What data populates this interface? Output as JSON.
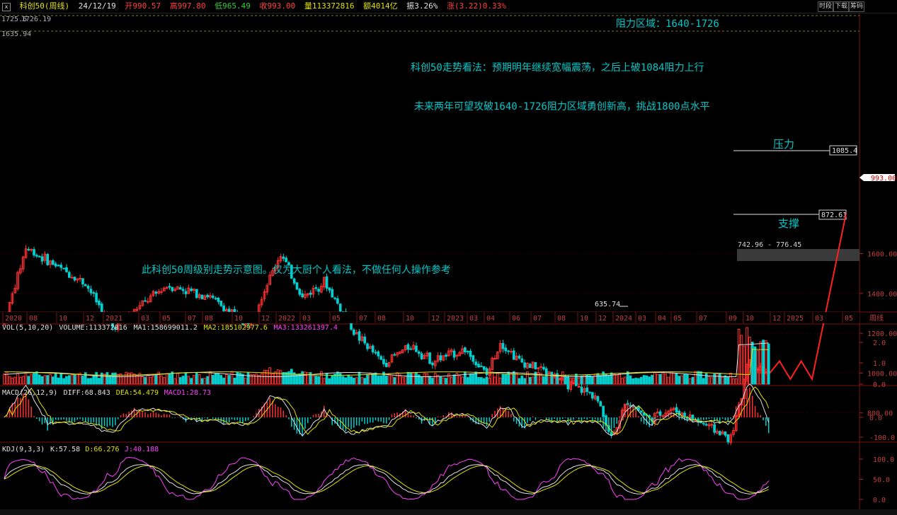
{
  "header": {
    "title": "科创50(周线)",
    "date": "24/12/19",
    "open": "开990.57",
    "high": "高997.80",
    "low": "低965.49",
    "close": "收993.00",
    "volume": "量113372816",
    "amount": "额4014亿",
    "amplitude": "振3.26%",
    "change": "涨(3.22)0.33%",
    "buttons": [
      "时段",
      "下载",
      "筹码"
    ]
  },
  "indicators": {
    "vol": [
      "VOL(5,10,20)",
      "VOLUME:113372816",
      "MA1:158699011.2",
      "MA2:185102977.6",
      "MA3:133261397.4"
    ],
    "macd": [
      "MACD(26,12,9)",
      "DIFF:68.843",
      "DEA:54.479",
      "MACD1:28.73"
    ],
    "kdj": [
      "KDJ(9,3,3)",
      "K:57.58",
      "D:66.276",
      "J:40.188"
    ]
  },
  "annotations": {
    "resistance_zone": "阻力区域：1640-1726",
    "forecast_1": "科创50走势看法：预期明年继续宽幅震荡，之后上破1084阻力上行",
    "forecast_2": "未来两年可望攻破1640-1726阻力区域勇创新高，挑战1800点水平",
    "disclaimer": "此科创50周级别走势示意图。仅为大厨个人看法，不做任何人操作参考",
    "pressure": "压力",
    "support": "支撑",
    "level_high1": "1725.6",
    "level_high2": "1726.19",
    "level_1640": "1635.94",
    "level_1085": "1085.4",
    "level_872": "872.61",
    "range": "742.96 - 776.45",
    "low_635": "635.74",
    "current": "993.00"
  },
  "colors": {
    "up": "#ff3030",
    "down": "#00d0d0",
    "grid": "#3a0000",
    "ma1": "#e0e0e0",
    "ma2": "#e0e000",
    "ma3": "#ff40ff",
    "annot": "#00c8c8",
    "dashed": "#7a7a2a"
  },
  "chart_data": {
    "type": "candlestick",
    "timeframe": "weekly",
    "x_ticks": [
      "2020",
      "08",
      "10",
      "12",
      "2021",
      "03",
      "05",
      "07",
      "08",
      "10",
      "12",
      "2022",
      "03",
      "05",
      "07",
      "08",
      "10",
      "12",
      "2023",
      "03",
      "04",
      "06",
      "07",
      "08",
      "10",
      "12",
      "2024",
      "03",
      "04",
      "05",
      "07",
      "09",
      "10",
      "12",
      "2025",
      "03",
      "05"
    ],
    "price_axis": [
      1600,
      1400,
      1200,
      1000,
      800
    ],
    "ylim": [
      600,
      1800
    ],
    "current_price": 993.0,
    "key_points": [
      {
        "week": 0,
        "price": 1250
      },
      {
        "week": 8,
        "price": 1630
      },
      {
        "week": 30,
        "price": 1450
      },
      {
        "week": 40,
        "price": 1230
      },
      {
        "week": 60,
        "price": 1440
      },
      {
        "week": 75,
        "price": 1390
      },
      {
        "week": 90,
        "price": 1240
      },
      {
        "week": 102,
        "price": 1600
      },
      {
        "week": 110,
        "price": 1380
      },
      {
        "week": 118,
        "price": 1460
      },
      {
        "week": 130,
        "price": 1190
      },
      {
        "week": 140,
        "price": 1050
      },
      {
        "week": 150,
        "price": 1140
      },
      {
        "week": 158,
        "price": 1060
      },
      {
        "week": 170,
        "price": 1120
      },
      {
        "week": 178,
        "price": 990
      },
      {
        "week": 183,
        "price": 1160
      },
      {
        "week": 190,
        "price": 1060
      },
      {
        "week": 200,
        "price": 1010
      },
      {
        "week": 210,
        "price": 930
      },
      {
        "week": 218,
        "price": 890
      },
      {
        "week": 224,
        "price": 680
      },
      {
        "week": 230,
        "price": 860
      },
      {
        "week": 238,
        "price": 770
      },
      {
        "week": 246,
        "price": 820
      },
      {
        "week": 258,
        "price": 745
      },
      {
        "week": 268,
        "price": 670
      },
      {
        "week": 272,
        "price": 880
      },
      {
        "week": 274,
        "price": 1060
      },
      {
        "week": 282,
        "price": 993
      }
    ],
    "forecast_path": [
      {
        "week": 282,
        "price": 993
      },
      {
        "week": 286,
        "price": 1060
      },
      {
        "week": 290,
        "price": 970
      },
      {
        "week": 294,
        "price": 1060
      },
      {
        "week": 298,
        "price": 970
      },
      {
        "week": 316,
        "price": 1800
      }
    ],
    "levels": [
      1726,
      1640,
      1085.4,
      872.61
    ],
    "volume_axis": [
      "2.0",
      "1.0",
      "0.0"
    ],
    "macd_axis": [
      "0.0",
      "-100.0"
    ],
    "kdj_axis": [
      "100.0",
      "50.0",
      "0.0"
    ]
  }
}
